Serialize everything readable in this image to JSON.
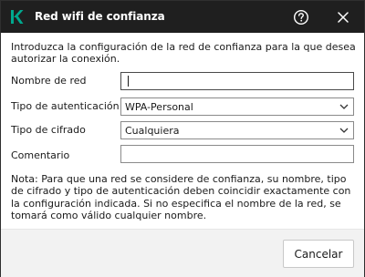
{
  "window": {
    "title": "Red wifi de confianza",
    "logo_icon": "kaspersky-k-logo",
    "accent_color": "#00a88e"
  },
  "intro_text": "Introduzca la configuración de la red de confianza para la que desea autorizar la conexión.",
  "form": {
    "network_name": {
      "label": "Nombre de red",
      "value": ""
    },
    "auth_type": {
      "label": "Tipo de autenticación",
      "value": "WPA-Personal"
    },
    "encryption_type": {
      "label": "Tipo de cifrado",
      "value": "Cualquiera"
    },
    "comment": {
      "label": "Comentario",
      "value": ""
    }
  },
  "note": "Nota: Para que una red se considere de confianza, su nombre, tipo de cifrado y tipo de autenticación deben coincidir exactamente con la configuración indicada. Si no especifica el nombre de la red, se tomará como válido cualquier nombre.",
  "footer": {
    "cancel_label": "Cancelar"
  }
}
